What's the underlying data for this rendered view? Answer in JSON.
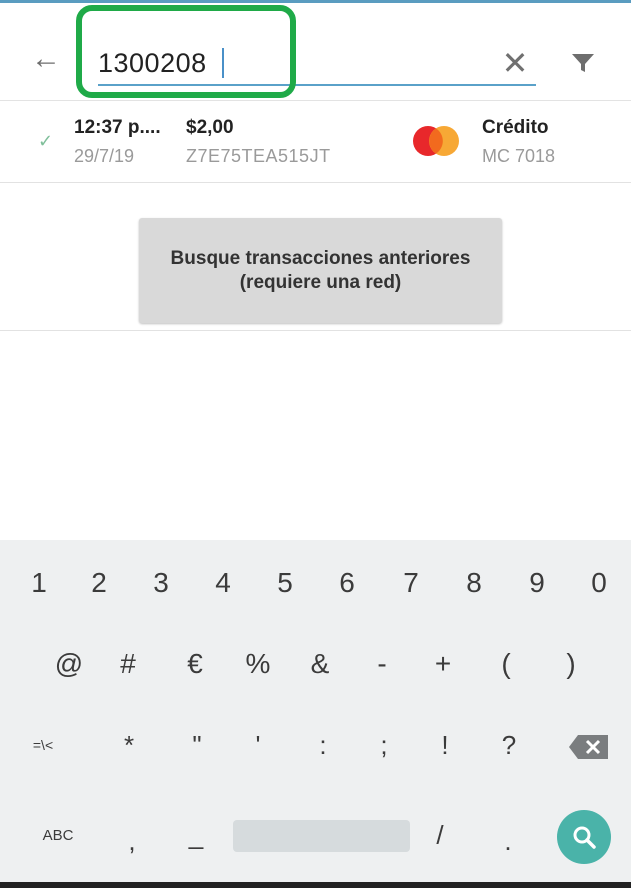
{
  "search": {
    "query": "1300208",
    "placeholder": ""
  },
  "transaction": {
    "time": "12:37 p....",
    "amount": "$2,00",
    "date": "29/7/19",
    "id": "Z7E75TEA515JT",
    "card_type": "Crédito",
    "card_number": "MC 7018"
  },
  "older_button": {
    "label": "Busque transacciones anteriores (requiere una red)"
  },
  "keyboard": {
    "row1": [
      "1",
      "2",
      "3",
      "4",
      "5",
      "6",
      "7",
      "8",
      "9",
      "0"
    ],
    "row2": [
      "@",
      "#",
      "€",
      "%",
      "&",
      "-",
      "+",
      "(",
      ")"
    ],
    "row3": [
      "=\\<",
      "*",
      "\"",
      "'",
      ":",
      ";",
      "!",
      "?"
    ],
    "row4": {
      "abc": "ABC",
      "comma": ",",
      "underscore": "_",
      "slash": "/",
      "period": "."
    }
  },
  "colors": {
    "highlight": "#1faa48",
    "accent": "#5aa1c9",
    "search_key": "#4ab3a9"
  },
  "icons": {
    "back": "arrow-left-icon",
    "clear": "close-icon",
    "filter": "filter-icon",
    "status": "check-icon",
    "card": "mastercard-icon",
    "backspace": "backspace-icon",
    "search": "search-icon"
  }
}
